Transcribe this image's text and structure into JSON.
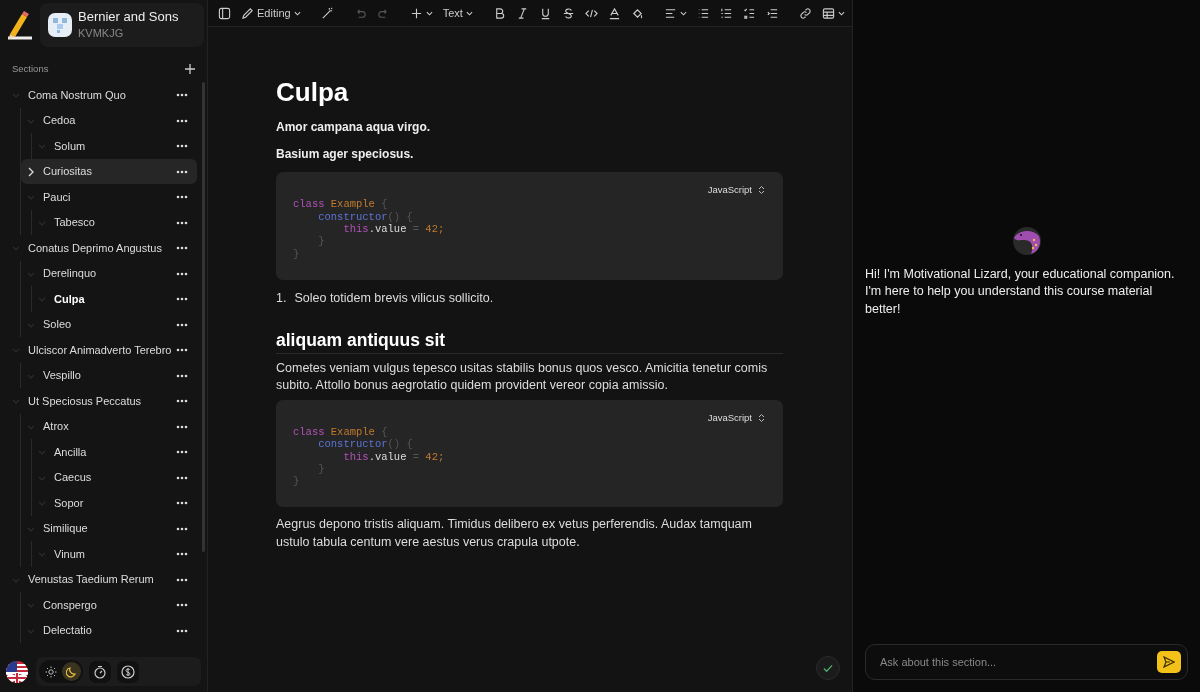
{
  "workspace": {
    "name": "Bernier and Sons",
    "code": "KVMKJG"
  },
  "sections": {
    "title": "Sections",
    "items": [
      {
        "label": "Coma Nostrum Quo",
        "selected": false,
        "hovered": false,
        "children": [
          {
            "label": "Cedoa",
            "selected": false,
            "hovered": false,
            "children": [
              {
                "label": "Solum",
                "selected": false,
                "hovered": false
              }
            ]
          },
          {
            "label": "Curiositas",
            "selected": false,
            "hovered": true
          },
          {
            "label": "Pauci",
            "selected": false,
            "hovered": false,
            "children": [
              {
                "label": "Tabesco",
                "selected": false,
                "hovered": false
              }
            ]
          }
        ]
      },
      {
        "label": "Conatus Deprimo Angustus",
        "selected": false,
        "hovered": false,
        "children": [
          {
            "label": "Derelinquo",
            "selected": false,
            "hovered": false,
            "children": [
              {
                "label": "Culpa",
                "selected": true,
                "hovered": false
              }
            ]
          },
          {
            "label": "Soleo",
            "selected": false,
            "hovered": false
          }
        ]
      },
      {
        "label": "Ulciscor Animadverto Terebro",
        "selected": false,
        "hovered": false,
        "children": [
          {
            "label": "Vespillo",
            "selected": false,
            "hovered": false
          }
        ]
      },
      {
        "label": "Ut Speciosus Peccatus",
        "selected": false,
        "hovered": false,
        "children": [
          {
            "label": "Atrox",
            "selected": false,
            "hovered": false,
            "children": [
              {
                "label": "Ancilla",
                "selected": false,
                "hovered": false
              },
              {
                "label": "Caecus",
                "selected": false,
                "hovered": false
              },
              {
                "label": "Sopor",
                "selected": false,
                "hovered": false
              }
            ]
          },
          {
            "label": "Similique",
            "selected": false,
            "hovered": false,
            "children": [
              {
                "label": "Vinum",
                "selected": false,
                "hovered": false
              }
            ]
          }
        ]
      },
      {
        "label": "Venustas Taedium Rerum",
        "selected": false,
        "hovered": false,
        "children": [
          {
            "label": "Conspergo",
            "selected": false,
            "hovered": false
          },
          {
            "label": "Delectatio",
            "selected": false,
            "hovered": false
          }
        ]
      }
    ]
  },
  "footer": {
    "dark_mode": true
  },
  "toolbar": {
    "mode": "Editing",
    "block_type": "Text",
    "undo_disabled": true,
    "redo_disabled": true
  },
  "document": [
    {
      "kind": "h1",
      "text": "Culpa"
    },
    {
      "kind": "bold",
      "text": "Amor campana aqua virgo."
    },
    {
      "kind": "bold",
      "text": "Basium ager speciosus."
    },
    {
      "kind": "code",
      "language": "JavaScript",
      "lines": [
        [
          {
            "t": "class ",
            "color": "#b052b8"
          },
          {
            "t": "Example ",
            "color": "#c07a2c"
          },
          {
            "t": "{",
            "color": "#555555"
          }
        ],
        [
          {
            "t": "    constructor",
            "color": "#5b74d6"
          },
          {
            "t": "() {",
            "color": "#555555"
          }
        ],
        [
          {
            "t": "        this",
            "color": "#b052b8"
          },
          {
            "t": ".value ",
            "color": "#dddddd"
          },
          {
            "t": "= ",
            "color": "#555555"
          },
          {
            "t": "42;",
            "color": "#c07a2c"
          }
        ],
        [
          {
            "t": "    }",
            "color": "#555555"
          }
        ],
        [
          {
            "t": "}",
            "color": "#555555"
          }
        ]
      ]
    },
    {
      "kind": "ol",
      "number": "1.",
      "text": "Soleo totidem brevis vilicus sollicito."
    },
    {
      "kind": "h2",
      "text": "aliquam antiquus sit"
    },
    {
      "kind": "p",
      "text": "Cometes veniam vulgus tepesco usitas stabilis bonus quos vesco. Amicitia tenetur comis subito. Attollo bonus aegrotatio quidem provident vereor copia amissio."
    },
    {
      "kind": "code",
      "language": "JavaScript",
      "lines": [
        [
          {
            "t": "class ",
            "color": "#b052b8"
          },
          {
            "t": "Example ",
            "color": "#c07a2c"
          },
          {
            "t": "{",
            "color": "#555555"
          }
        ],
        [
          {
            "t": "    constructor",
            "color": "#5b74d6"
          },
          {
            "t": "() {",
            "color": "#555555"
          }
        ],
        [
          {
            "t": "        this",
            "color": "#b052b8"
          },
          {
            "t": ".value ",
            "color": "#dddddd"
          },
          {
            "t": "= ",
            "color": "#555555"
          },
          {
            "t": "42;",
            "color": "#c07a2c"
          }
        ],
        [
          {
            "t": "    }",
            "color": "#555555"
          }
        ],
        [
          {
            "t": "}",
            "color": "#555555"
          }
        ]
      ]
    },
    {
      "kind": "p",
      "text": "Aegrus depono tristis aliquam. Timidus delibero ex vetus perferendis. Audax tamquam ustulo tabula centum vere aestus verus crapula utpote."
    }
  ],
  "saved": true,
  "assistant": {
    "message": "Hi! I'm Motivational Lizard, your educational companion. I'm here to help you understand this course material better!",
    "placeholder": "Ask about this section..."
  }
}
